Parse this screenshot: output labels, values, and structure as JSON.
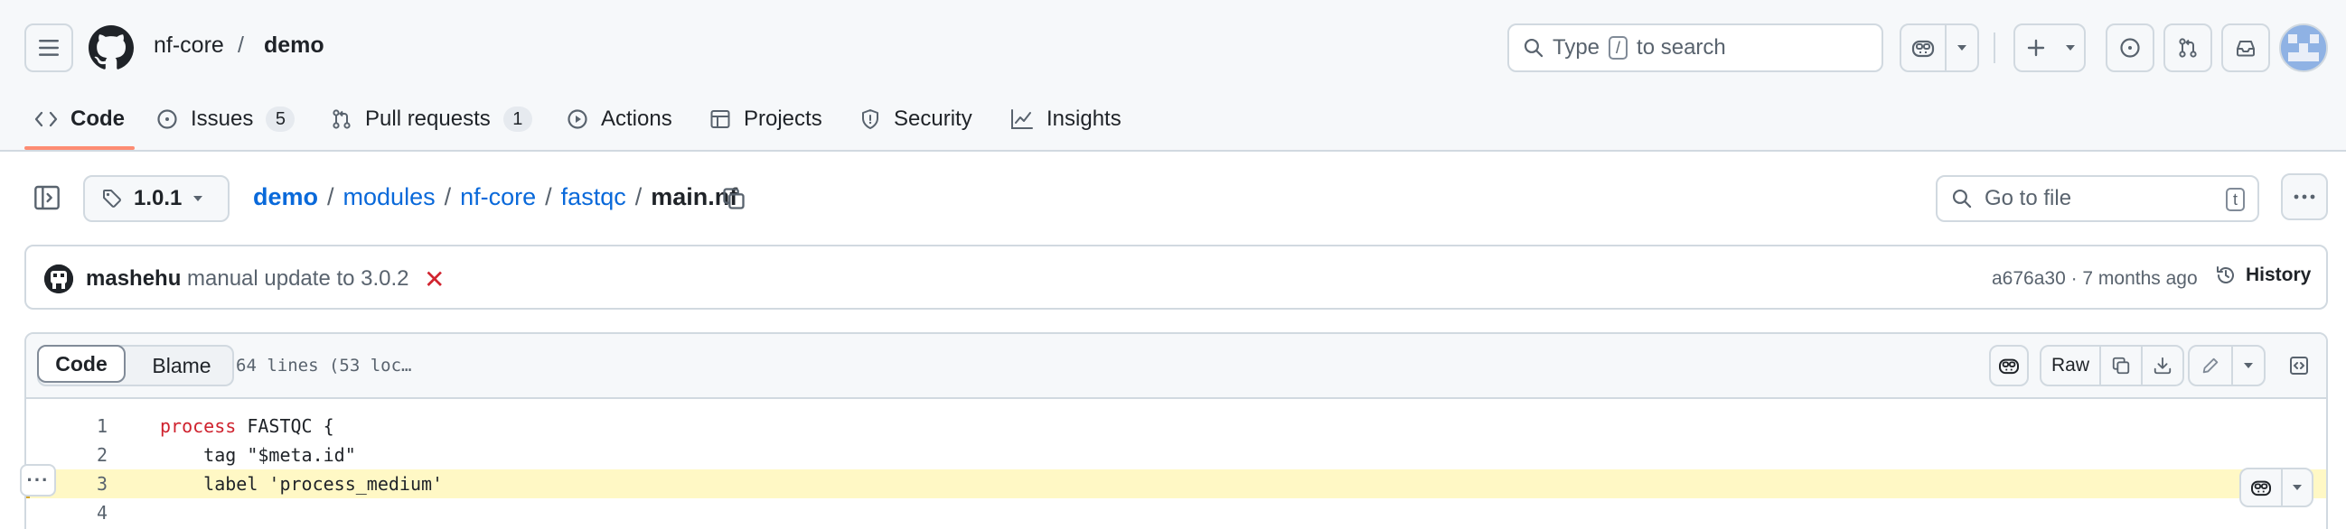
{
  "header": {
    "owner": "nf-core",
    "slash": "/",
    "repo": "demo",
    "search": {
      "prefix": "Type",
      "key": "/",
      "suffix": "to search"
    },
    "tabs": [
      {
        "label": "Code",
        "icon": "code-icon"
      },
      {
        "label": "Issues",
        "icon": "issue-opened-icon",
        "count": "5"
      },
      {
        "label": "Pull requests",
        "icon": "git-pull-request-icon",
        "count": "1"
      },
      {
        "label": "Actions",
        "icon": "play-icon"
      },
      {
        "label": "Projects",
        "icon": "table-icon"
      },
      {
        "label": "Security",
        "icon": "shield-icon"
      },
      {
        "label": "Insights",
        "icon": "graph-icon"
      }
    ]
  },
  "file_nav": {
    "branch": "1.0.1",
    "path": [
      {
        "label": "demo"
      },
      {
        "label": "modules"
      },
      {
        "label": "nf-core"
      },
      {
        "label": "fastqc"
      }
    ],
    "path_sep": "/",
    "file_name": "main.nf",
    "goto_file": {
      "placeholder": "Go to file",
      "key": "t"
    }
  },
  "commit": {
    "author": "mashehu",
    "message": "manual update to 3.0.2",
    "status": "✕",
    "meta": "a676a30 · 7 months ago",
    "history_label": "History"
  },
  "code_view": {
    "tabs": {
      "code": "Code",
      "blame": "Blame"
    },
    "lines_info": "64 lines (53 loc…",
    "raw_label": "Raw",
    "line_menu": "···",
    "lines": [
      {
        "number": "1",
        "keyword": "process",
        "text": " FASTQC {"
      },
      {
        "number": "2",
        "keyword": "",
        "text": "    tag \"$meta.id\""
      },
      {
        "number": "3",
        "keyword": "",
        "text": "    label 'process_medium'"
      },
      {
        "number": "4",
        "keyword": "",
        "text": ""
      }
    ]
  },
  "colors": {
    "link": "#0969da",
    "active_tab_underline": "#fd8c73",
    "keyword": "#cf222e",
    "highlight": "#fff8c5",
    "error": "#d1242f"
  }
}
